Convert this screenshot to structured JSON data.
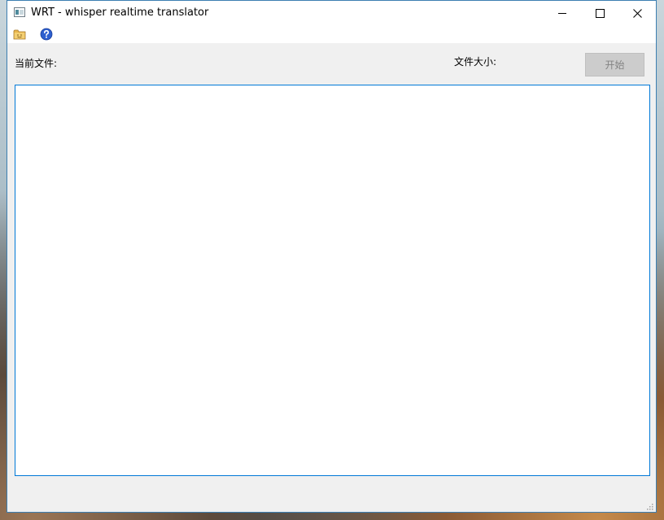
{
  "window": {
    "title": "WRT - whisper realtime translator"
  },
  "toolbar": {
    "items": [
      {
        "icon": "folder-open-icon"
      },
      {
        "icon": "help-icon"
      }
    ]
  },
  "main": {
    "current_file_label": "当前文件:",
    "file_size_label": "文件大小:",
    "start_button_label": "开始",
    "start_button_enabled": false,
    "output_text": ""
  },
  "colors": {
    "accent": "#0078d7",
    "window_bg": "#f0f0f0",
    "disabled_button": "#cccccc",
    "disabled_text": "#838383"
  }
}
